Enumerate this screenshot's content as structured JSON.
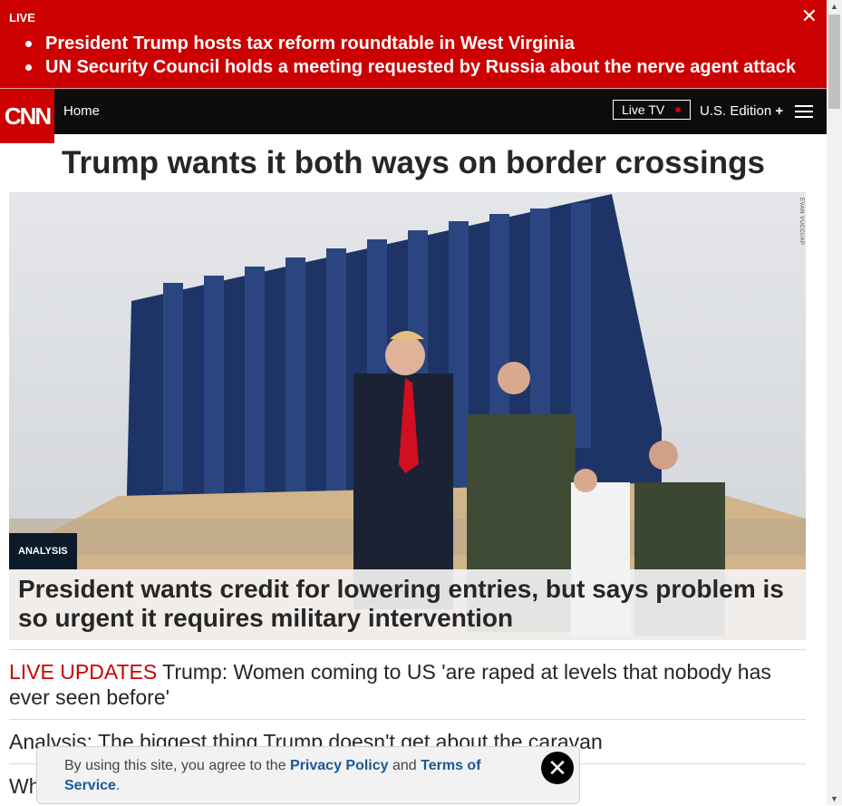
{
  "live_banner": {
    "label": "LIVE",
    "close_glyph": "✕",
    "items": [
      "President Trump hosts tax reform roundtable in West Virginia",
      "UN Security Council holds a meeting requested by Russia about the nerve agent attack"
    ]
  },
  "nav": {
    "logo_text": "CNN",
    "home_label": "Home",
    "live_tv_label": "Live TV",
    "edition_label": "U.S. Edition",
    "edition_plus": "+"
  },
  "headline": "Trump wants it both ways on border crossings",
  "hero": {
    "photo_credit": "EVAN VUCCI/AP",
    "badge": "ANALYSIS",
    "caption": "President wants credit for lowering entries, but says problem is so urgent it requires military intervention"
  },
  "stories": [
    {
      "tag": "LIVE UPDATES",
      "text": " Trump: Women coming to US 'are raped at levels that nobody has ever seen before'"
    },
    {
      "tag": "",
      "text": "Analysis: The biggest thing Trump doesn't get about the caravan"
    },
    {
      "tag": "",
      "text": "Wh"
    }
  ],
  "privacy": {
    "prefix": "By using this site, you agree to the ",
    "privacy_link": "Privacy Policy",
    "and": " and ",
    "terms_link": "Terms of Service",
    "suffix": ".",
    "close_glyph": "✕"
  },
  "colors": {
    "brand_red": "#cc0000",
    "nav_black": "#0c0c0c",
    "link_blue": "#1a5a96"
  }
}
